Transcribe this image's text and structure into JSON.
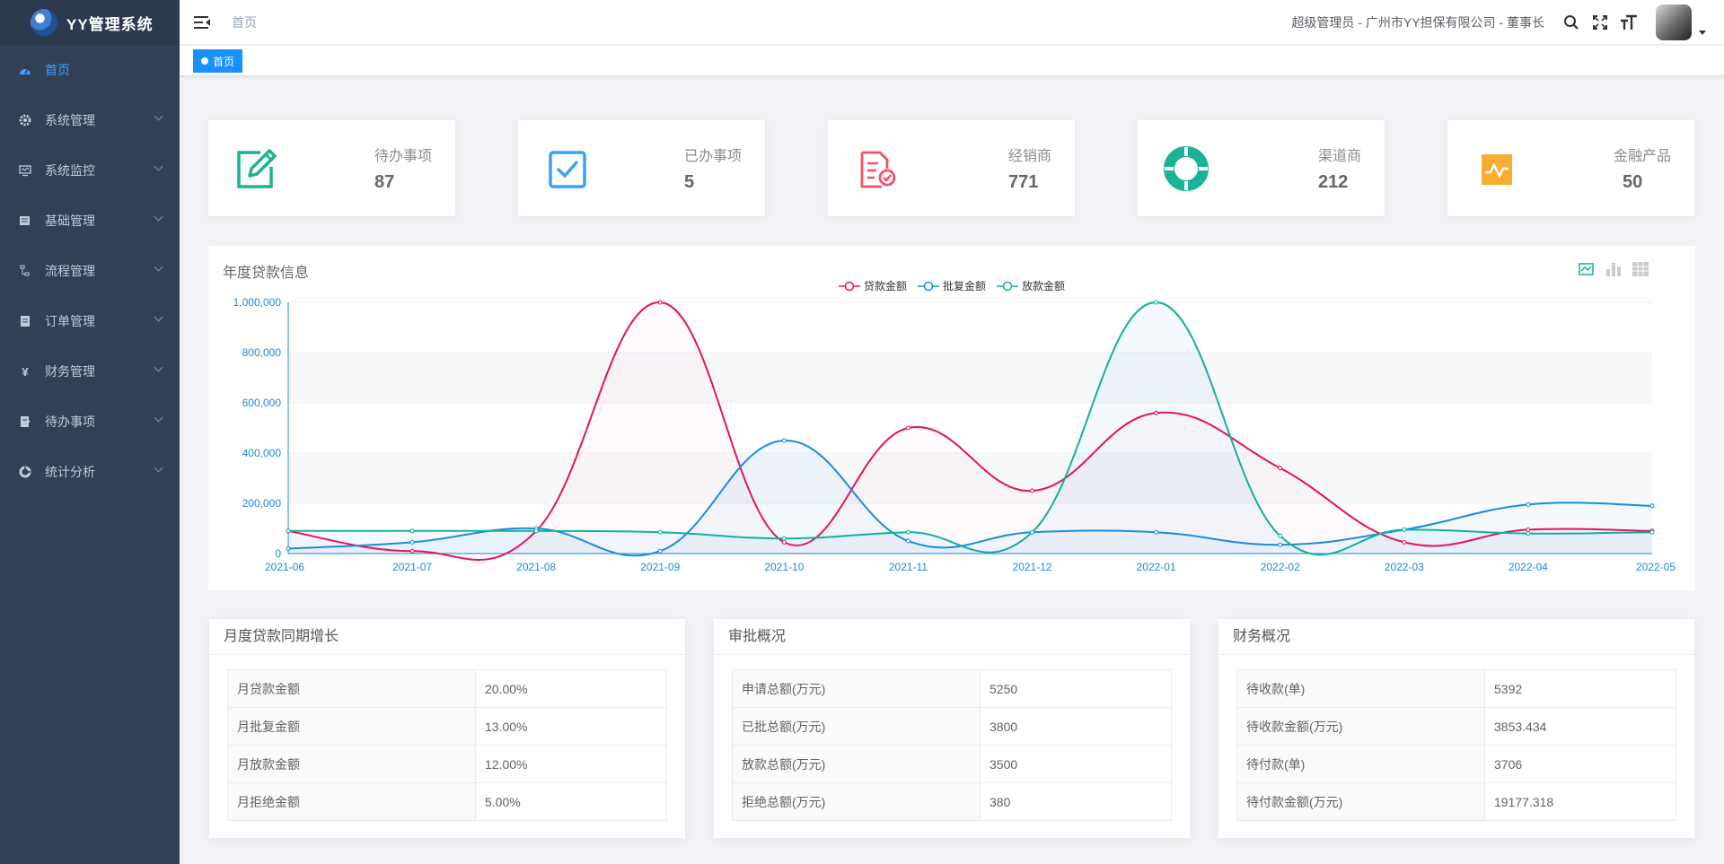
{
  "app": {
    "title": "YY管理系统"
  },
  "sidebar": {
    "items": [
      {
        "label": "首页",
        "icon": "dashboard-icon",
        "active": true
      },
      {
        "label": "系统管理",
        "icon": "gear-icon"
      },
      {
        "label": "系统监控",
        "icon": "monitor-icon"
      },
      {
        "label": "基础管理",
        "icon": "database-icon"
      },
      {
        "label": "流程管理",
        "icon": "flow-icon"
      },
      {
        "label": "订单管理",
        "icon": "order-icon"
      },
      {
        "label": "财务管理",
        "icon": "yen-icon"
      },
      {
        "label": "待办事项",
        "icon": "todo-icon"
      },
      {
        "label": "统计分析",
        "icon": "stats-icon"
      }
    ]
  },
  "header": {
    "breadcrumb": "首页",
    "user_info": "超级管理员 - 广州市YY担保有限公司 - 董事长"
  },
  "tags": {
    "active": "首页"
  },
  "stats": [
    {
      "label": "待办事项",
      "value": "87",
      "color": "#1ab394"
    },
    {
      "label": "已办事项",
      "value": "5",
      "color": "#36a3f7"
    },
    {
      "label": "经销商",
      "value": "771",
      "color": "#f4516c"
    },
    {
      "label": "渠道商",
      "value": "212",
      "color": "#1ab394"
    },
    {
      "label": "金融产品",
      "value": "50",
      "color": "#f8ac30"
    }
  ],
  "chart_panel": {
    "title": "年度贷款信息"
  },
  "chart_data": {
    "type": "line",
    "title": "年度贷款信息",
    "categories": [
      "2021-06",
      "2021-07",
      "2021-08",
      "2021-09",
      "2021-10",
      "2021-11",
      "2021-12",
      "2022-01",
      "2022-02",
      "2022-03",
      "2022-04",
      "2022-05"
    ],
    "ylim": [
      0,
      1000000
    ],
    "yticks": [
      "0",
      "200,000",
      "400,000",
      "600,000",
      "800,000",
      "1,000,000"
    ],
    "smooth": true,
    "grid": true,
    "legend": "top-center",
    "series": [
      {
        "name": "贷款金额",
        "color": "#e6125a",
        "values": [
          90000,
          10000,
          90000,
          1000000,
          45000,
          500000,
          250000,
          560000,
          340000,
          45000,
          95000,
          90000
        ]
      },
      {
        "name": "批复金额",
        "color": "#1a8be0",
        "values": [
          20000,
          45000,
          100000,
          10000,
          450000,
          50000,
          85000,
          85000,
          35000,
          95000,
          195000,
          190000
        ]
      },
      {
        "name": "放款金额",
        "color": "#13b09b",
        "values": [
          90000,
          90000,
          90000,
          85000,
          60000,
          85000,
          85000,
          1000000,
          70000,
          95000,
          80000,
          85000
        ]
      }
    ]
  },
  "panels": [
    {
      "title": "月度贷款同期增长",
      "rows": [
        {
          "k": "月贷款金额",
          "v": "20.00%"
        },
        {
          "k": "月批复金额",
          "v": "13.00%"
        },
        {
          "k": "月放款金额",
          "v": "12.00%"
        },
        {
          "k": "月拒绝金额",
          "v": "5.00%"
        }
      ]
    },
    {
      "title": "审批概况",
      "rows": [
        {
          "k": "申请总额(万元)",
          "v": "5250"
        },
        {
          "k": "已批总额(万元)",
          "v": "3800"
        },
        {
          "k": "放款总额(万元)",
          "v": "3500"
        },
        {
          "k": "拒绝总额(万元)",
          "v": "380"
        }
      ]
    },
    {
      "title": "财务概况",
      "rows": [
        {
          "k": "待收款(单)",
          "v": "5392"
        },
        {
          "k": "待收款金额(万元)",
          "v": "3853.434"
        },
        {
          "k": "待付款(单)",
          "v": "3706"
        },
        {
          "k": "待付款金额(万元)",
          "v": "19177.318"
        }
      ]
    }
  ]
}
